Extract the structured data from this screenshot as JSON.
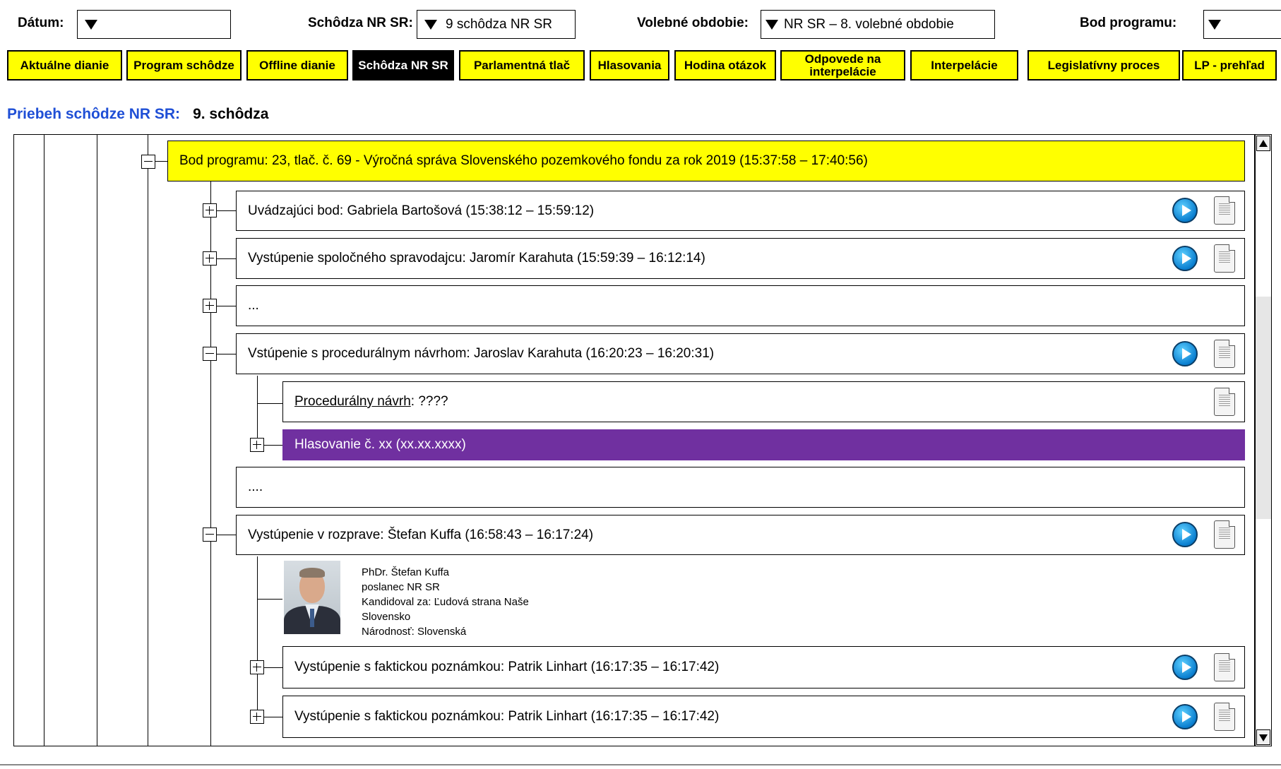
{
  "filters": {
    "datum_label": "Dátum:",
    "datum_value": "",
    "schodza_label": "Schôdza NR SR:",
    "schodza_value": "9 schôdza NR SR",
    "obdobie_label": "Volebné obdobie:",
    "obdobie_value": "NR SR – 8. volebné obdobie",
    "bod_label": "Bod programu:",
    "bod_value": ""
  },
  "tabs": [
    {
      "label": "Aktuálne dianie"
    },
    {
      "label": "Program schôdze"
    },
    {
      "label": "Offline dianie"
    },
    {
      "label": "Schôdza NR SR",
      "active": true
    },
    {
      "label": "Parlamentná tlač"
    },
    {
      "label": "Hlasovania"
    },
    {
      "label": "Hodina otázok"
    },
    {
      "label": "Odpovede na interpelácie"
    },
    {
      "label": "Interpelácie"
    },
    {
      "label": "Legislatívny proces"
    },
    {
      "label": "LP - prehľad"
    }
  ],
  "heading": {
    "label": "Priebeh schôdze NR SR:",
    "value": "9. schôdza"
  },
  "tree": {
    "bod": "Bod programu: 23, tlač. č. 69 - Výročná správa Slovenského pozemkového fondu za rok 2019 (15:37:58 – 17:40:56)",
    "items": {
      "uvadzajuci": "Uvádzajúci bod: Gabriela Bartošová (15:38:12 – 15:59:12)",
      "spravodajca": "Vystúpenie spoločného spravodajcu: Jaromír Karahuta (15:59:39 – 16:12:14)",
      "ellipsis1": "...",
      "proceduralny": "Vstúpenie s procedurálnym návrhom: Jaroslav Karahuta (16:20:23 – 16:20:31)",
      "navrh_link": "Procedurálny návrh",
      "navrh_rest": ": ????",
      "hlasovanie": "Hlasovanie č. xx (xx.xx.xxxx)",
      "ellipsis2": "....",
      "rozprava": "Vystúpenie v rozprave: Štefan Kuffa (16:58:43 – 16:17:24)",
      "fakticka1": "Vystúpenie s faktickou poznámkou: Patrik Linhart (16:17:35 – 16:17:42)",
      "fakticka2": "Vystúpenie s faktickou poznámkou: Patrik Linhart (16:17:35 – 16:17:42)"
    },
    "profile": {
      "name": "PhDr. Štefan Kuffa",
      "role": "poslanec NR SR",
      "kandidoval": "Kandidoval za: Ľudová strana Naše",
      "kandidoval2": "Slovensko",
      "narodnost": "Národnosť: Slovenská"
    }
  },
  "colors": {
    "tab_bg": "#ffff00",
    "tab_active_bg": "#000000",
    "heading_label": "#1f4fd6",
    "bod_bg": "#ffff00",
    "hlasovanie_bg": "#7030a0"
  },
  "icons": [
    "play-icon",
    "document-icon",
    "dropdown-arrow-icon",
    "expand-icon",
    "collapse-icon"
  ]
}
